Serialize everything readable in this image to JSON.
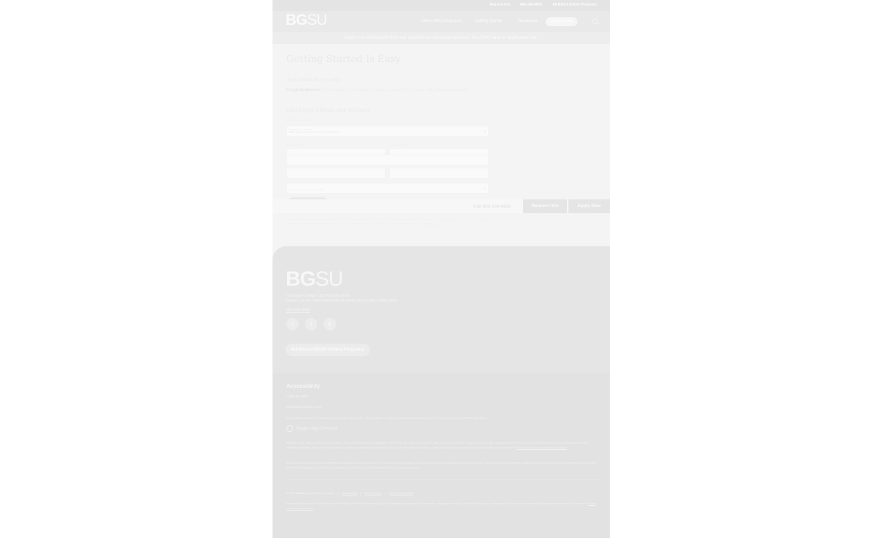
{
  "utility_bar": {
    "request_info": "Request Info",
    "phone": "866-269-4859",
    "all_programs": "All BGSU Online Programs"
  },
  "navbar": {
    "logo_bold": "BG",
    "logo_thin": "SU",
    "items": [
      "Online MBA Programs",
      "Getting Started",
      "Resources"
    ],
    "apply": "Apply Now",
    "search_icon": "search-icon"
  },
  "promo": "Apply now and benefit from our streamlined admission process. No GMAT and no application fee.",
  "main": {
    "title": "Getting Started Is Easy",
    "subhead": "Just follow these steps.",
    "intro_bold": "Congratulations!",
    "intro_text": " You're taking the first step in shaping a future for yourself with great opportunities.",
    "choose": "Let's begin! Choose your program:",
    "required": "All fields required"
  },
  "form": {
    "program_label": "Program of Interest*",
    "program_value": "MBA with a Concentration in Finance",
    "first_name": "First Name*",
    "last_name": "Last Name*",
    "email": "Email*",
    "phone": "Phone*",
    "zip": "ZIP Code*",
    "hear": "How did you hear about us?*"
  },
  "sticky": {
    "call": "Call 866-269-4859",
    "request": "Request Info",
    "apply": "Apply Now"
  },
  "disclaimer": {
    "text": "By submitting this form, I am providing my consent to receive communication from BGSU about its programs via phone, email, text message or similar methods. I understand that message and data rates may apply and that I may opt out at any time. This consent is not required to enroll. I have read and agree to the",
    "link": "Privacy Policy"
  },
  "footer": {
    "logo_bold": "BG",
    "logo_thin": "SU",
    "address_line1": "Graduate College  |  220 McFall Center",
    "address_line2": "Bowling Green State University  |  Bowling Green, Ohio 43403-0001",
    "phone": "866-269-4859",
    "social": [
      {
        "name": "facebook-icon",
        "glyph": "f"
      },
      {
        "name": "twitter-icon",
        "glyph": "t"
      },
      {
        "name": "instagram-icon",
        "glyph": "o"
      }
    ],
    "additional_programs": "Additional BGSU Online Programs",
    "accessibility_title": "Accessibility",
    "skip_link": "Skip to main",
    "accessibility_summary": "Accessibility Summary Page:",
    "accessibility_para1": "BGSU offers alternative versions of all of the pages on this site. You can adjust the high contrast version below to change the look of your BGSU website experience.",
    "contrast_button": "Toggle High Contrast",
    "accessibility_para2": "Bowling Green State University (BGSU) has built its website around the standards of the World Wide Web Consortium's (W3C) Hyper Text Markup Language (HTML) and Cascading Style Sheets (CSS). The website was built in accordance with the standards in Section 508 of the Rehabilitation Act and the standards in section 504 of the Code of Federal Regulations. These standards ensure that content is accessible and usable by all.",
    "accessibility_link": "Please contact us for an alternate format",
    "accessibility_para3": "BGSU values input and provides website accessibility via a web-based form. If you believe content within the BGSU website is not accessible, please contact the Office of Accessibility Services, Marketing and Communications and Information Technology Services. Every page is reviewed for accessibility issues and reports are forwarded to the appropriate parties.",
    "copyright": "© 2022 Bowling Green State University",
    "legal_links": [
      "Accessibility",
      "Privacy Policy",
      "Terms & Conditions"
    ],
    "notice": "Program information is provided on behalf of Bowling Green State University. BGSU maintains responsibility for curriculum, teaching, admissions, tuition, financial aid, accreditation, and all other academic and administrative functions and decisions.",
    "notice_link": "Learn more about Academic"
  }
}
